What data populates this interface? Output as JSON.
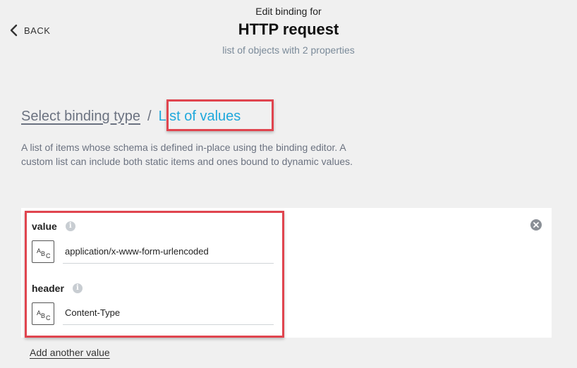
{
  "header": {
    "back_label": "BACK",
    "subtitle": "Edit binding for",
    "title": "HTTP request",
    "description": "list of objects with 2 properties"
  },
  "breadcrumb": {
    "link": "Select binding type",
    "separator": "/",
    "current": "List of values"
  },
  "description": "A list of items whose schema is defined in-place using the binding editor. A custom list can include both static items and ones bound to dynamic values.",
  "fields": [
    {
      "label": "value",
      "type_icon": "text-type-icon",
      "value": "application/x-www-form-urlencoded"
    },
    {
      "label": "header",
      "type_icon": "text-type-icon",
      "value": "Content-Type"
    }
  ],
  "type_icon_letters": [
    "A",
    "B",
    "C"
  ],
  "info_glyph": "i",
  "add_link": "Add another value",
  "colors": {
    "accent": "#1fa8dc",
    "highlight": "#e0454f",
    "muted": "#6b7280"
  }
}
